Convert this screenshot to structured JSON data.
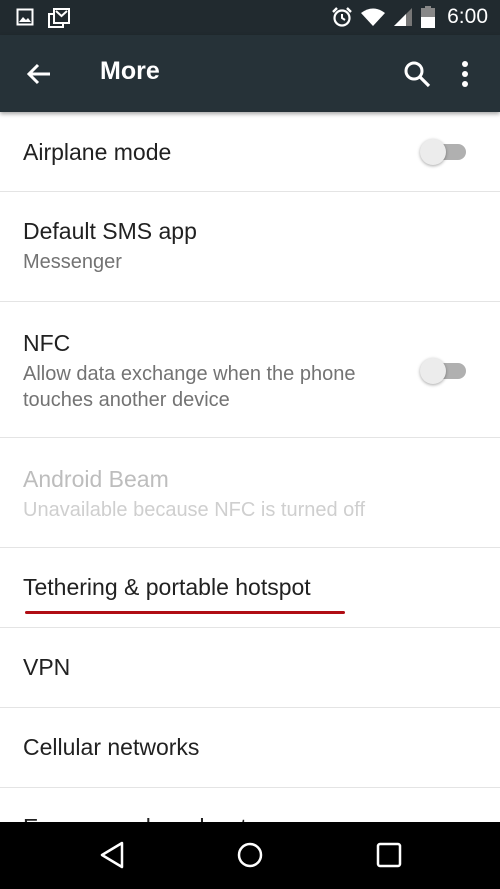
{
  "status_bar": {
    "left_icons": [
      "image-notification-icon",
      "gmail-notification-icon"
    ],
    "right_icons": [
      "alarm-icon",
      "wifi-icon",
      "cell-signal-icon",
      "battery-icon"
    ],
    "time": "6:00"
  },
  "app_bar": {
    "title": "More",
    "back_icon": "arrow-back-icon",
    "search_icon": "search-icon",
    "overflow_icon": "more-vert-icon",
    "background": "#263238"
  },
  "settings": [
    {
      "title": "Airplane mode",
      "subtitle": null,
      "toggle": true,
      "toggle_on": false,
      "enabled": true
    },
    {
      "title": "Default SMS app",
      "subtitle": "Messenger",
      "toggle": false,
      "enabled": true
    },
    {
      "title": "NFC",
      "subtitle": "Allow data exchange when the phone touches another device",
      "subtitle_lines": [
        "Allow data exchange when the phone",
        "touches another device"
      ],
      "toggle": true,
      "toggle_on": false,
      "enabled": true
    },
    {
      "title": "Android Beam",
      "subtitle": "Unavailable because NFC is turned off",
      "toggle": false,
      "enabled": false
    },
    {
      "title": "Tethering & portable hotspot",
      "subtitle": null,
      "toggle": false,
      "enabled": true,
      "highlighted": true,
      "highlight_color": "#b00d14"
    },
    {
      "title": "VPN",
      "subtitle": null,
      "toggle": false,
      "enabled": true
    },
    {
      "title": "Cellular networks",
      "subtitle": null,
      "toggle": false,
      "enabled": true
    },
    {
      "title": "Emergency broadcasts",
      "subtitle": null,
      "toggle": false,
      "enabled": true,
      "clipped": true
    }
  ],
  "nav_bar": {
    "back": "nav-back-icon",
    "home": "nav-home-icon",
    "recents": "nav-recents-icon"
  }
}
